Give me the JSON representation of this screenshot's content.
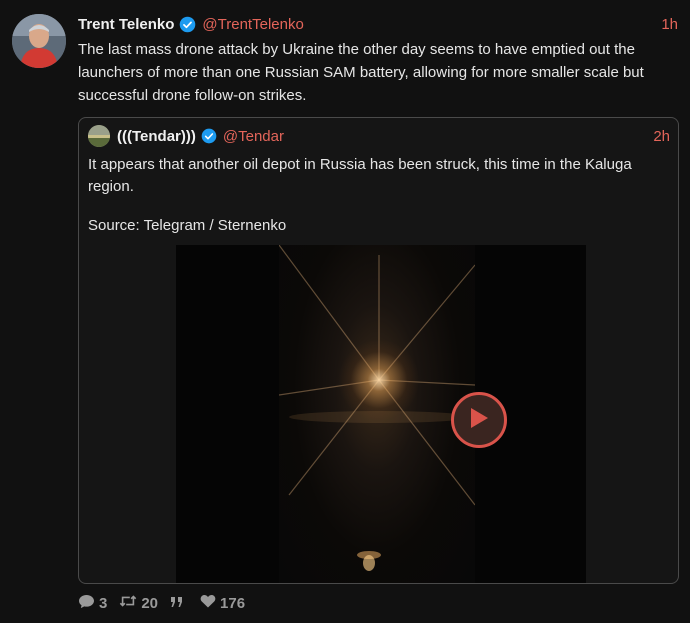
{
  "post": {
    "author": "Trent Telenko",
    "handle": "@TrentTelenko",
    "time": "1h",
    "text": "The last mass drone attack by Ukraine the other day seems to have emptied out the launchers of more than one Russian SAM battery, allowing for more smaller scale but successful drone follow-on strikes."
  },
  "quote": {
    "author": "(((Tendar)))",
    "handle": "@Tendar",
    "time": "2h",
    "text": "It appears that another oil depot in Russia has been struck, this time in the Kaluga region.",
    "source": "Source: Telegram / Sternenko"
  },
  "actions": {
    "replies": "3",
    "retweets": "20",
    "likes": "176"
  },
  "icons": [
    "verified-icon",
    "comment-icon",
    "retweet-icon",
    "quote-icon",
    "heart-icon",
    "play-icon"
  ],
  "colors": {
    "accent": "#e3655a",
    "verified": "#1d9bf0",
    "background": "#111111"
  }
}
